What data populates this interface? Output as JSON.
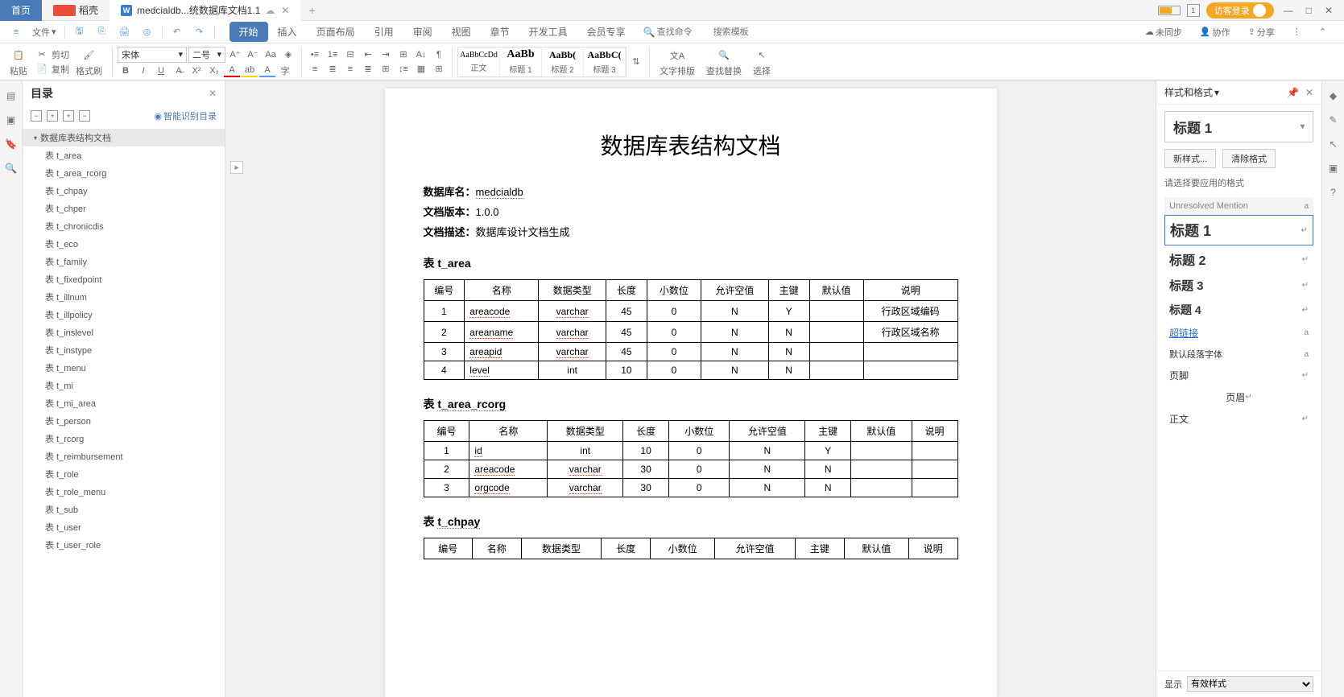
{
  "titlebar": {
    "home": "首页",
    "shell": "稻壳",
    "doc_tab": "medcialdb...统数据库文档1.1",
    "guest_login": "访客登录",
    "minimize": "—",
    "maximize": "□",
    "close": "✕"
  },
  "toolbar": {
    "file": "文件",
    "search_placeholder": "查找命令",
    "template_placeholder": "搜索模板",
    "unsync": "未同步",
    "coop": "协作",
    "share": "分享"
  },
  "ribbon_tabs": [
    "开始",
    "插入",
    "页面布局",
    "引用",
    "审阅",
    "视图",
    "章节",
    "开发工具",
    "会员专享"
  ],
  "ribbon": {
    "paste": "粘贴",
    "cut": "剪切",
    "copy": "复制",
    "format_painter": "格式刷",
    "font_name": "宋体",
    "font_size": "二号",
    "styles": [
      {
        "preview": "AaBbCcDd",
        "label": "正文"
      },
      {
        "preview": "AaBb",
        "label": "标题 1"
      },
      {
        "preview": "AaBb(",
        "label": "标题 2"
      },
      {
        "preview": "AaBbC(",
        "label": "标题 3"
      }
    ],
    "text_layout": "文字排版",
    "find_replace": "查找替换",
    "select": "选择"
  },
  "toc": {
    "title": "目录",
    "smart": "智能识别目录",
    "root": "数据库表结构文档",
    "items": [
      "表 t_area",
      "表 t_area_rcorg",
      "表 t_chpay",
      "表 t_chper",
      "表 t_chronicdis",
      "表 t_eco",
      "表 t_family",
      "表 t_fixedpoint",
      "表 t_illnum",
      "表 t_illpolicy",
      "表 t_inslevel",
      "表 t_instype",
      "表 t_menu",
      "表 t_mi",
      "表 t_mi_area",
      "表 t_person",
      "表 t_rcorg",
      "表 t_reimbursement",
      "表 t_role",
      "表 t_role_menu",
      "表 t_sub",
      "表 t_user",
      "表 t_user_role"
    ]
  },
  "document": {
    "title": "数据库表结构文档",
    "meta_dbname_label": "数据库名：",
    "meta_dbname": "medcialdb",
    "meta_version_label": "文档版本：",
    "meta_version": "1.0.0",
    "meta_desc_label": "文档描述：",
    "meta_desc": "数据库设计文档生成",
    "table_headers": [
      "编号",
      "名称",
      "数据类型",
      "长度",
      "小数位",
      "允许空值",
      "主键",
      "默认值",
      "说明"
    ],
    "section1": "表 t_area",
    "t_area": [
      {
        "no": "1",
        "name": "areacode",
        "type": "varchar",
        "len": "45",
        "dec": "0",
        "null": "N",
        "pk": "Y",
        "def": "",
        "desc": "行政区域编码"
      },
      {
        "no": "2",
        "name": "areaname",
        "type": "varchar",
        "len": "45",
        "dec": "0",
        "null": "N",
        "pk": "N",
        "def": "",
        "desc": "行政区域名称"
      },
      {
        "no": "3",
        "name": "areapid",
        "type": "varchar",
        "len": "45",
        "dec": "0",
        "null": "N",
        "pk": "N",
        "def": "",
        "desc": ""
      },
      {
        "no": "4",
        "name": "level",
        "type": "int",
        "len": "10",
        "dec": "0",
        "null": "N",
        "pk": "N",
        "def": "",
        "desc": ""
      }
    ],
    "section2": "表 t_area_rcorg",
    "t_area_rcorg": [
      {
        "no": "1",
        "name": "id",
        "type": "int",
        "len": "10",
        "dec": "0",
        "null": "N",
        "pk": "Y",
        "def": "",
        "desc": ""
      },
      {
        "no": "2",
        "name": "areacode",
        "type": "varchar",
        "len": "30",
        "dec": "0",
        "null": "N",
        "pk": "N",
        "def": "",
        "desc": ""
      },
      {
        "no": "3",
        "name": "orgcode",
        "type": "varchar",
        "len": "30",
        "dec": "0",
        "null": "N",
        "pk": "N",
        "def": "",
        "desc": ""
      }
    ],
    "section3": "表 t_chpay"
  },
  "style_panel": {
    "title": "样式和格式",
    "current": "标题 1",
    "new_style": "新样式...",
    "clear": "清除格式",
    "hint": "请选择要应用的格式",
    "items": [
      {
        "label": "Unresolved Mention",
        "mark": "a",
        "cls": "dim",
        "size": "11px"
      },
      {
        "label": "标题 1",
        "mark": "↵",
        "cls": "selected",
        "size": "18px",
        "bold": true
      },
      {
        "label": "标题 2",
        "mark": "↵",
        "size": "16px",
        "bold": true
      },
      {
        "label": "标题 3",
        "mark": "↵",
        "size": "15px",
        "bold": true
      },
      {
        "label": "标题 4",
        "mark": "↵",
        "size": "14px",
        "bold": true
      },
      {
        "label": "超链接",
        "mark": "a",
        "cls": "link",
        "size": "12px"
      },
      {
        "label": "默认段落字体",
        "mark": "a",
        "size": "11px"
      },
      {
        "label": "页脚",
        "mark": "↵",
        "size": "12px"
      },
      {
        "label": "页眉",
        "mark": "↵",
        "size": "12px",
        "align": "center"
      },
      {
        "label": "正文",
        "mark": "↵",
        "size": "12px"
      }
    ],
    "show_label": "显示",
    "show_value": "有效样式"
  }
}
